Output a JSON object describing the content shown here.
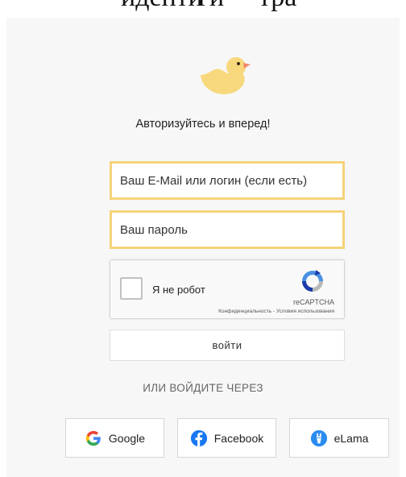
{
  "top_text": [
    "иденти",
    "ги",
    "тра"
  ],
  "heading": "Авторизуйтесь и вперед!",
  "login_field": {
    "placeholder": "Ваш E-Mail или логин (если есть)",
    "value": ""
  },
  "password_field": {
    "placeholder": "Ваш пароль",
    "value": ""
  },
  "captcha": {
    "label": "Я не робот",
    "brand": "reCAPTCHA",
    "links": "Конфиденциальность - Условия использования",
    "checked": false
  },
  "login_button": "войти",
  "or_text": "ИЛИ ВОЙДИТЕ ЧЕРЕЗ",
  "social": {
    "google": "Google",
    "facebook": "Facebook",
    "elama": "eLama"
  },
  "colors": {
    "accent_border": "#f6d37a",
    "duck_body": "#f8d87c",
    "duck_beak": "#f08a6b",
    "facebook_blue": "#1877f2",
    "elama_blue": "#2a8cf0"
  },
  "icons": [
    "duck-logo-icon",
    "recaptcha-icon",
    "google-icon",
    "facebook-icon",
    "elama-icon"
  ]
}
